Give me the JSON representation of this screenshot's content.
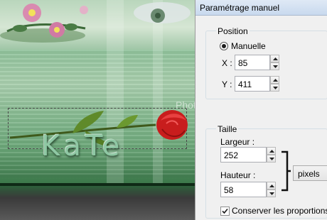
{
  "canvas": {
    "text_art": "KaTe",
    "watermark": "PhotoFiltreGraphic"
  },
  "dialog": {
    "title": "Paramétrage manuel",
    "position": {
      "legend": "Position",
      "mode_label": "Manuelle",
      "mode_selected": true,
      "x_label": "X :",
      "x_value": "85",
      "y_label": "Y :",
      "y_value": "411"
    },
    "size": {
      "legend": "Taille",
      "width_label": "Largeur :",
      "width_value": "252",
      "height_label": "Hauteur :",
      "height_value": "58",
      "unit_value": "pixels",
      "keep_ratio_label": "Conserver les proportions",
      "keep_ratio_checked": true
    }
  },
  "colors": {
    "canvas_green": "#6ea97b",
    "rose_red": "#d01f1f",
    "dialog_bg": "#f0f0f0",
    "titlebar": "#c8d9ee"
  },
  "icons": [
    "radio-selected-icon",
    "spin-up-arrow-icon",
    "spin-down-arrow-icon",
    "bracket-link-icon",
    "checkmark-icon"
  ]
}
